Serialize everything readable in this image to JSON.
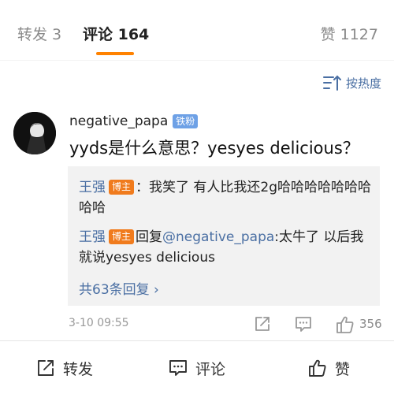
{
  "tabs": {
    "repost": "转发 3",
    "comments": "评论 164",
    "likes": "赞 1127"
  },
  "sort": {
    "label": "按热度"
  },
  "comment": {
    "username": "negative_papa",
    "fan_badge": "铁粉",
    "text": "yyds是什么意思？yesyes delicious？",
    "timestamp": "3-10 09:55",
    "like_count": "356"
  },
  "replies": [
    {
      "name": "王强",
      "badge": "博主",
      "text": "：我笑了 有人比我还2g哈哈哈哈哈哈哈哈哈"
    },
    {
      "name": "王强",
      "badge": "博主",
      "reply_word": "回复",
      "mention": "@negative_papa",
      "text": ":太牛了 以后我就说yesyes delicious"
    }
  ],
  "more_replies": "共63条回复 ›",
  "bottom_bar": {
    "repost": "转发",
    "comment": "评论",
    "like": "赞"
  },
  "colors": {
    "accent": "#ff8200",
    "link": "#4a6fa3",
    "host_badge": "#f07b1d",
    "fan_badge": "#6ea1e6"
  }
}
